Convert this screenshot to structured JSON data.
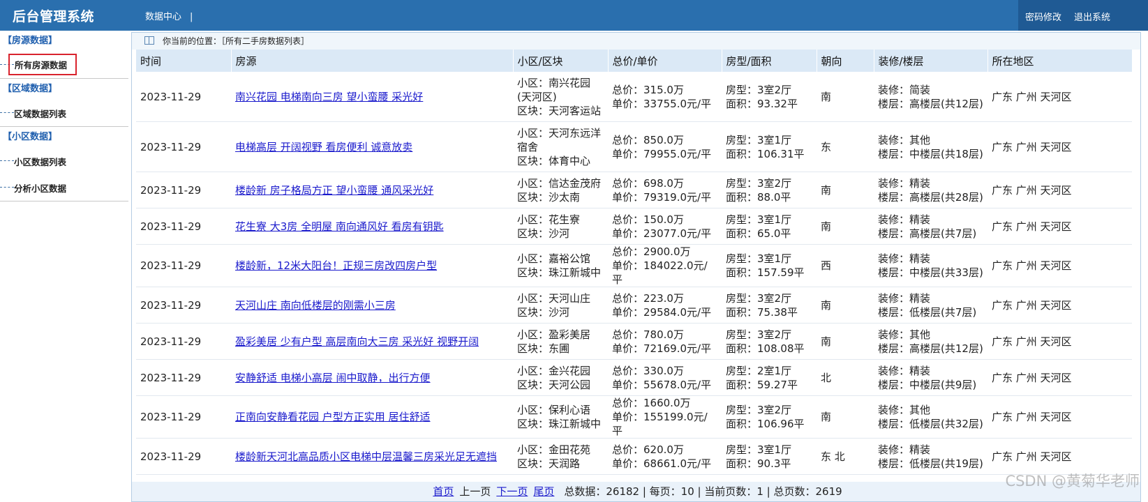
{
  "header": {
    "brand": "后台管理系统",
    "nav": "数据中心",
    "nav_sep": "|",
    "password": "密码修改",
    "logout": "退出系统"
  },
  "sidebar": {
    "groups": [
      {
        "title": "【房源数据】",
        "items": [
          "所有房源数据"
        ]
      },
      {
        "title": "【区域数据】",
        "items": [
          "区域数据列表"
        ]
      },
      {
        "title": "【小区数据】",
        "items": [
          "小区数据列表",
          "分析小区数据"
        ]
      }
    ]
  },
  "crumb": "你当前的位置：［所有二手房数据列表］",
  "table": {
    "headers": [
      "时间",
      "房源",
      "小区/区块",
      "总价/单价",
      "房型/面积",
      "朝向",
      "装修/楼层",
      "所在地区"
    ],
    "rows": [
      {
        "time": "2023-11-29",
        "title": "南兴花园 电梯南向三房 望小蛮腰 采光好",
        "xq": "小区：南兴花园(天河区)",
        "qk": "区块：天河客运站",
        "zj": "总价：315.0万",
        "dj": "单价：33755.0元/平",
        "fx": "房型：3室2厅",
        "mj": "面积：93.32平",
        "cx": "南",
        "zx": "装修：简装",
        "lc": "楼层：高楼层(共12层)",
        "dq": "广东 广州 天河区"
      },
      {
        "time": "2023-11-29",
        "title": "电梯高层 开阔视野 看房便利 诚意放卖",
        "xq": "小区：天河东远洋宿舍",
        "qk": "区块：体育中心",
        "zj": "总价：850.0万",
        "dj": "单价：79955.0元/平",
        "fx": "房型：3室1厅",
        "mj": "面积：106.31平",
        "cx": "东",
        "zx": "装修：其他",
        "lc": "楼层：中楼层(共18层)",
        "dq": "广东 广州 天河区"
      },
      {
        "time": "2023-11-29",
        "title": "楼龄新 房子格局方正 望小蛮腰 通风采光好",
        "xq": "小区：信达金茂府",
        "qk": "区块：沙太南",
        "zj": "总价：698.0万",
        "dj": "单价：79319.0元/平",
        "fx": "房型：3室2厅",
        "mj": "面积：88.0平",
        "cx": "南",
        "zx": "装修：精装",
        "lc": "楼层：高楼层(共28层)",
        "dq": "广东 广州 天河区"
      },
      {
        "time": "2023-11-29",
        "title": "花生寮 大3房 全明屋 南向通风好 看房有钥匙",
        "xq": "小区：花生寮",
        "qk": "区块：沙河",
        "zj": "总价：150.0万",
        "dj": "单价：23077.0元/平",
        "fx": "房型：3室1厅",
        "mj": "面积：65.0平",
        "cx": "南",
        "zx": "装修：精装",
        "lc": "楼层：高楼层(共7层)",
        "dq": "广东 广州 天河区"
      },
      {
        "time": "2023-11-29",
        "title": "楼龄新，12米大阳台！正规三房改四房户型",
        "xq": "小区：嘉裕公馆",
        "qk": "区块：珠江新城中",
        "zj": "总价：2900.0万",
        "dj": "单价：184022.0元/平",
        "fx": "房型：3室1厅",
        "mj": "面积：157.59平",
        "cx": "西",
        "zx": "装修：精装",
        "lc": "楼层：中楼层(共33层)",
        "dq": "广东 广州 天河区"
      },
      {
        "time": "2023-11-29",
        "title": "天河山庄 南向低楼层的刚需小三房",
        "xq": "小区：天河山庄",
        "qk": "区块：沙河",
        "zj": "总价：223.0万",
        "dj": "单价：29584.0元/平",
        "fx": "房型：3室2厅",
        "mj": "面积：75.38平",
        "cx": "南",
        "zx": "装修：精装",
        "lc": "楼层：低楼层(共7层)",
        "dq": "广东 广州 天河区"
      },
      {
        "time": "2023-11-29",
        "title": "盈彩美居 少有户型 高层南向大三房 采光好 视野开阔",
        "xq": "小区：盈彩美居",
        "qk": "区块：东圃",
        "zj": "总价：780.0万",
        "dj": "单价：72169.0元/平",
        "fx": "房型：3室2厅",
        "mj": "面积：108.08平",
        "cx": "南",
        "zx": "装修：其他",
        "lc": "楼层：高楼层(共12层)",
        "dq": "广东 广州 天河区"
      },
      {
        "time": "2023-11-29",
        "title": "安静舒适 电梯小高层 闹中取静，出行方便",
        "xq": "小区：金兴花园",
        "qk": "区块：天河公园",
        "zj": "总价：330.0万",
        "dj": "单价：55678.0元/平",
        "fx": "房型：2室1厅",
        "mj": "面积：59.27平",
        "cx": "北",
        "zx": "装修：精装",
        "lc": "楼层：中楼层(共9层)",
        "dq": "广东 广州 天河区"
      },
      {
        "time": "2023-11-29",
        "title": "正南向安静看花园 户型方正实用 居住舒适",
        "xq": "小区：保利心语",
        "qk": "区块：珠江新城中",
        "zj": "总价：1660.0万",
        "dj": "单价：155199.0元/平",
        "fx": "房型：3室2厅",
        "mj": "面积：106.96平",
        "cx": "南",
        "zx": "装修：其他",
        "lc": "楼层：低楼层(共32层)",
        "dq": "广东 广州 天河区"
      },
      {
        "time": "2023-11-29",
        "title": "楼龄新天河北高品质小区电梯中层温馨三房采光足无遮挡",
        "xq": "小区：金田花苑",
        "qk": "区块：天润路",
        "zj": "总价：620.0万",
        "dj": "单价：68661.0元/平",
        "fx": "房型：3室1厅",
        "mj": "面积：90.3平",
        "cx": "东 北",
        "zx": "装修：精装",
        "lc": "楼层：低楼层(共19层)",
        "dq": "广东 广州 天河区"
      }
    ]
  },
  "pager": {
    "first": "首页",
    "prev": "上一页",
    "next": "下一页",
    "last": "尾页",
    "stats": "总数据：26182 | 每页：10 | 当前页数：1 | 总页数：2619"
  },
  "watermark": "CSDN @黄菊华老师"
}
